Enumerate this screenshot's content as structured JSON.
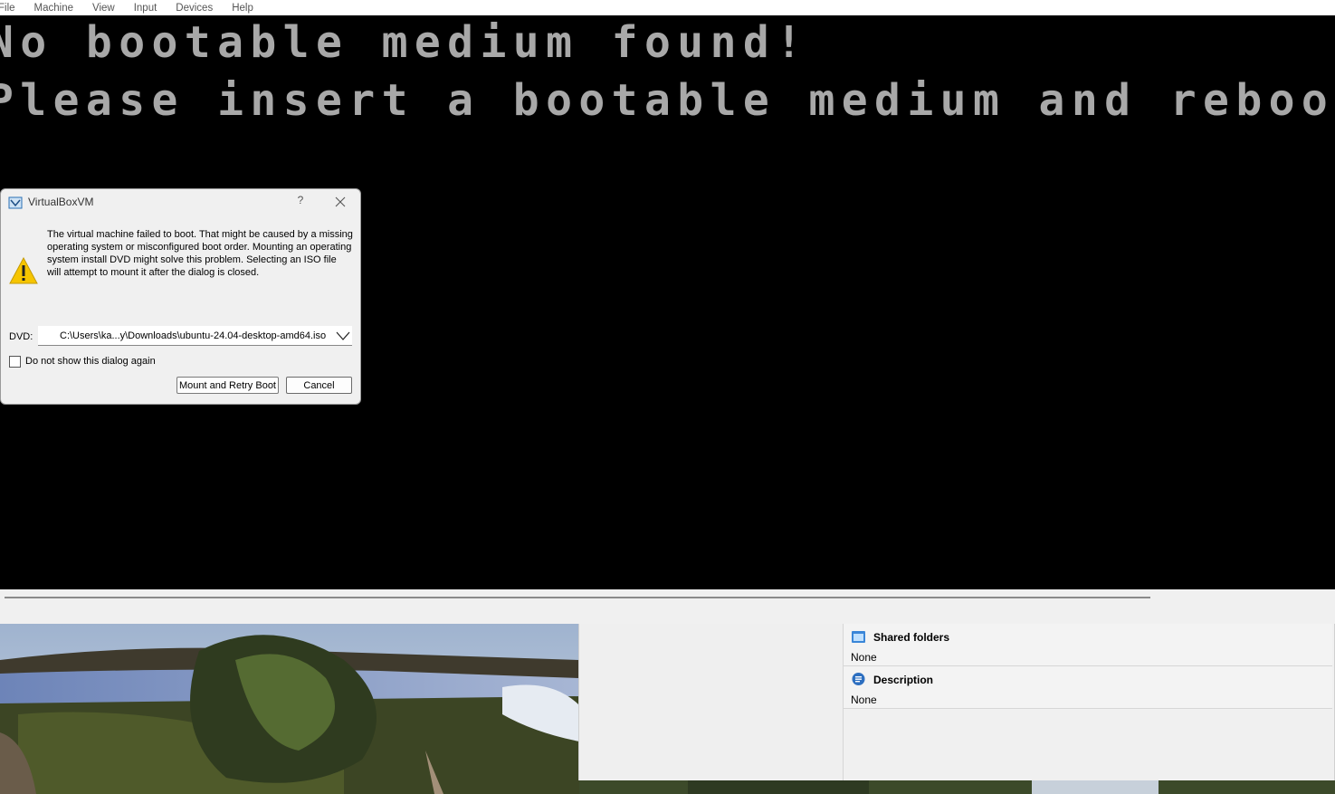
{
  "menubar": {
    "items": [
      "File",
      "Machine",
      "View",
      "Input",
      "Devices",
      "Help"
    ]
  },
  "vm_screen": {
    "line1": "No bootable medium found!",
    "line2": "Please insert a bootable medium and reboot"
  },
  "dialog": {
    "title": "VirtualBoxVM",
    "help_glyph": "?",
    "icon": "warning-icon",
    "message": "The virtual machine failed to boot. That might be caused by a missing operating system or misconfigured boot order. Mounting an operating system install DVD might solve this problem. Selecting an ISO file will attempt to mount it after the dialog is closed.",
    "dvd_label": "DVD:",
    "dvd_value": "C:\\Users\\ka...y\\Downloads\\ubuntu-24.04-desktop-amd64.iso",
    "checkbox_label": "Do not show this dialog again",
    "checkbox_checked": false,
    "mount_button": "Mount and Retry Boot",
    "cancel_button": "Cancel"
  },
  "details_panel": {
    "shared_folders": {
      "title": "Shared folders",
      "value": "None",
      "icon": "folder-icon"
    },
    "description": {
      "title": "Description",
      "value": "None",
      "icon": "speech-bubble-icon"
    }
  },
  "colors": {
    "bios_text": "#a8a8a8",
    "vm_background": "#000000",
    "dialog_background": "#f0f0f0"
  }
}
